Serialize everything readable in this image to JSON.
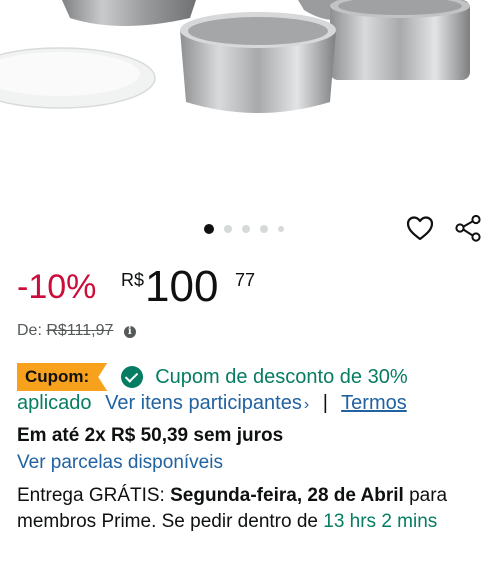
{
  "product_images": {
    "carousel_count": 5,
    "active_index": 0
  },
  "actions": {
    "favorite_icon": "heart-outline-icon",
    "share_icon": "share-icon"
  },
  "price": {
    "discount": "-10%",
    "currency": "R$",
    "whole": "100",
    "fraction": "77",
    "list_label": "De:",
    "list_price": "R$111,97"
  },
  "coupon": {
    "badge": "Cupom:",
    "text_part1": "Cupom de desconto de 30%",
    "text_part2": "aplicado",
    "participants_link": "Ver itens participantes",
    "chevron": "›",
    "separator": "|",
    "terms_link": "Termos"
  },
  "installments": {
    "text": "Em até 2x R$ 50,39 sem juros",
    "link": "Ver parcelas disponíveis"
  },
  "delivery": {
    "prefix": "Entrega GRÁTIS:",
    "date": "Segunda-feira, 28 de Abril",
    "middle": "para membros Prime. Se pedir dentro de",
    "countdown": "13 hrs 2 mins"
  },
  "colors": {
    "discount": "#cc0c39",
    "coupon_badge": "#f7a11c",
    "coupon_green": "#067d62",
    "link_blue": "#2162a1"
  }
}
